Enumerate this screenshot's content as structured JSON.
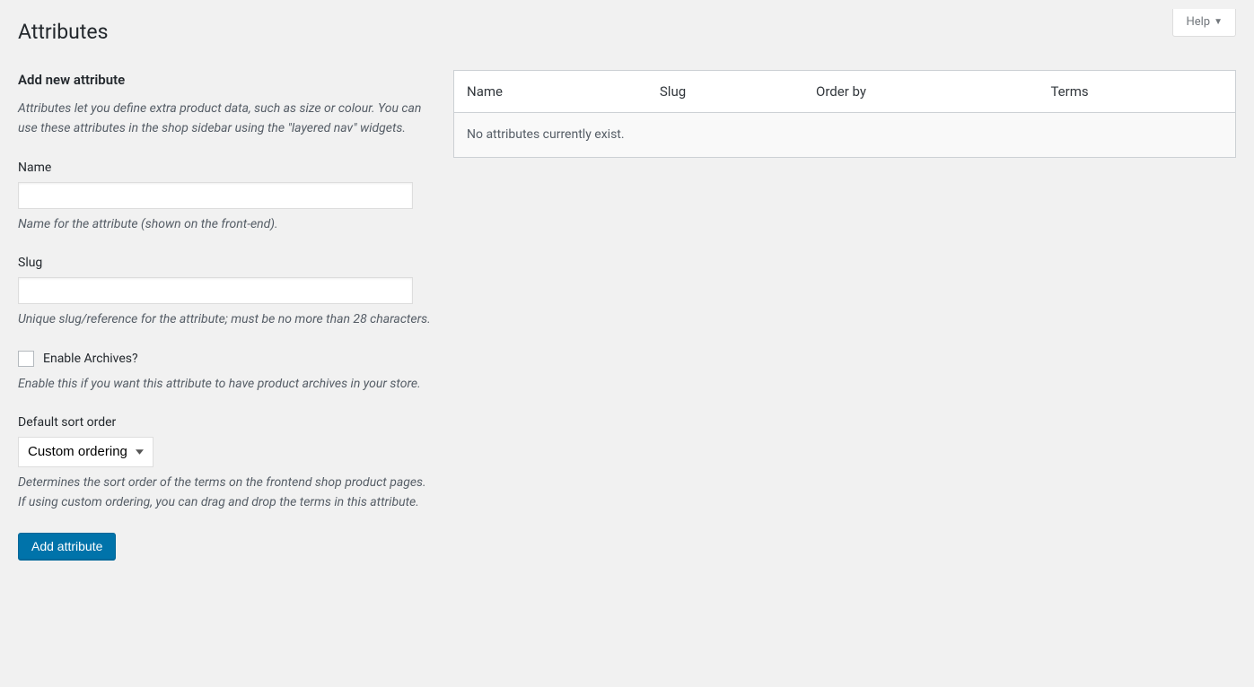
{
  "help": {
    "label": "Help"
  },
  "page": {
    "title": "Attributes"
  },
  "form": {
    "section_title": "Add new attribute",
    "intro": "Attributes let you define extra product data, such as size or colour. You can use these attributes in the shop sidebar using the \"layered nav\" widgets.",
    "name": {
      "label": "Name",
      "value": "",
      "desc": "Name for the attribute (shown on the front-end)."
    },
    "slug": {
      "label": "Slug",
      "value": "",
      "desc": "Unique slug/reference for the attribute; must be no more than 28 characters."
    },
    "archives": {
      "label": "Enable Archives?",
      "desc": "Enable this if you want this attribute to have product archives in your store."
    },
    "sort": {
      "label": "Default sort order",
      "selected": "Custom ordering",
      "desc": "Determines the sort order of the terms on the frontend shop product pages. If using custom ordering, you can drag and drop the terms in this attribute."
    },
    "submit": "Add attribute"
  },
  "table": {
    "headers": {
      "name": "Name",
      "slug": "Slug",
      "orderby": "Order by",
      "terms": "Terms"
    },
    "empty": "No attributes currently exist."
  }
}
